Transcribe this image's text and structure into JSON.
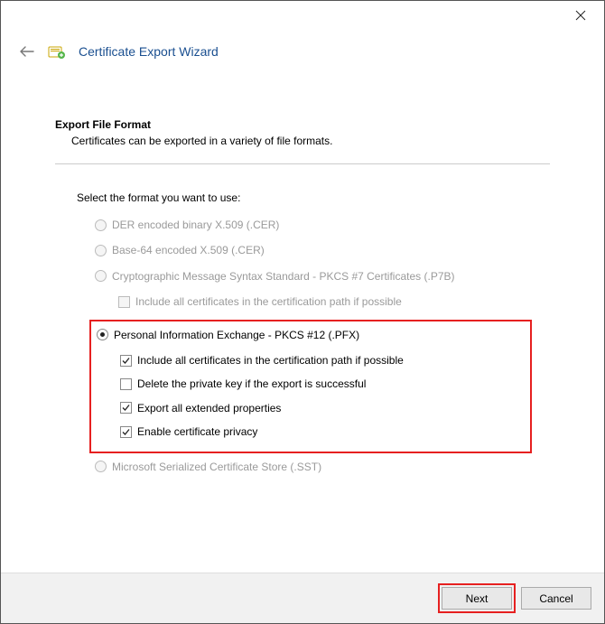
{
  "window_title": "Certificate Export Wizard",
  "section": {
    "heading": "Export File Format",
    "subtext": "Certificates can be exported in a variety of file formats."
  },
  "prompt": "Select the format you want to use:",
  "options": {
    "der": "DER encoded binary X.509 (.CER)",
    "base64": "Base-64 encoded X.509 (.CER)",
    "p7b": "Cryptographic Message Syntax Standard - PKCS #7 Certificates (.P7B)",
    "p7b_include": "Include all certificates in the certification path if possible",
    "pfx": "Personal Information Exchange - PKCS #12 (.PFX)",
    "pfx_include": "Include all certificates in the certification path if possible",
    "pfx_delete": "Delete the private key if the export is successful",
    "pfx_extended": "Export all extended properties",
    "pfx_privacy": "Enable certificate privacy",
    "sst": "Microsoft Serialized Certificate Store (.SST)"
  },
  "buttons": {
    "next": "Next",
    "cancel": "Cancel"
  }
}
